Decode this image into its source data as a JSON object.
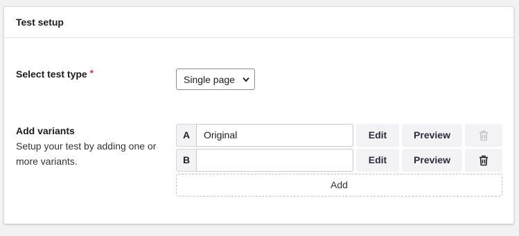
{
  "section": {
    "title": "Test setup"
  },
  "test_type": {
    "label": "Select test type",
    "required_marker": "*",
    "selected": "Single page"
  },
  "variants": {
    "label": "Add variants",
    "description": "Setup your test by adding one or more variants.",
    "rows": [
      {
        "letter": "A",
        "name": "Original",
        "edit_label": "Edit",
        "preview_label": "Preview",
        "delete_icon": "trash-icon",
        "delete_enabled": false
      },
      {
        "letter": "B",
        "name": "",
        "edit_label": "Edit",
        "preview_label": "Preview",
        "delete_icon": "trash-icon",
        "delete_enabled": true
      }
    ],
    "add_label": "Add"
  },
  "colors": {
    "required": "#d42054",
    "button_bg": "#f3f3f5",
    "disabled_icon": "#c4c4c4"
  }
}
